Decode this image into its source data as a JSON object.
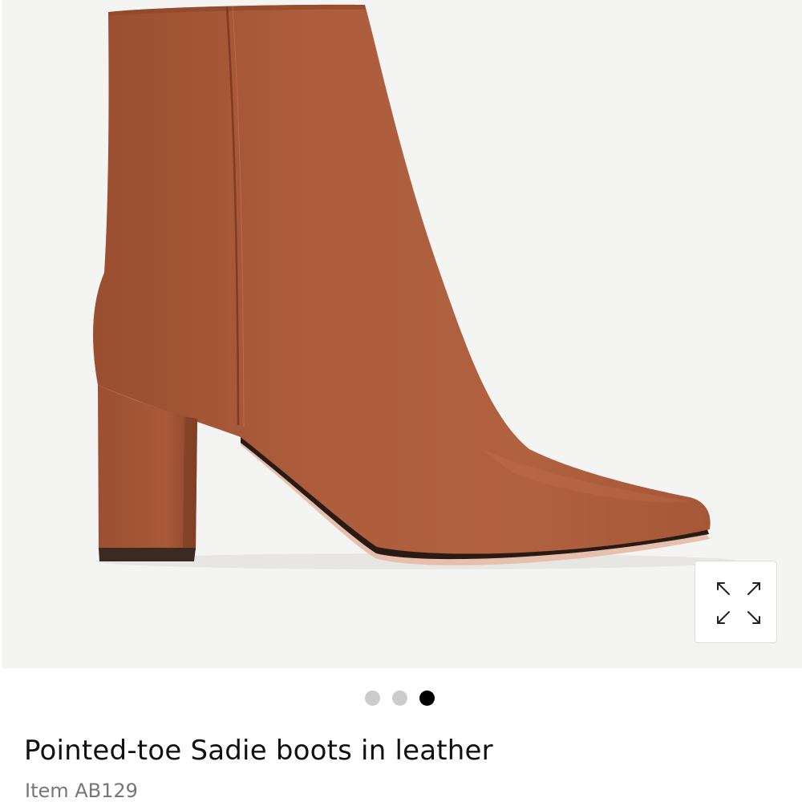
{
  "product": {
    "title": "Pointed-toe Sadie boots in leather",
    "item_number": "Item AB129"
  },
  "gallery": {
    "image_count": 3,
    "active_index": 2,
    "zoom_icon": "expand-arrows-icon"
  },
  "colors": {
    "hero_background": "#f4f4f2",
    "leather": "#a85a3a",
    "active_dot": "#000000",
    "inactive_dot": "#cccccc"
  }
}
